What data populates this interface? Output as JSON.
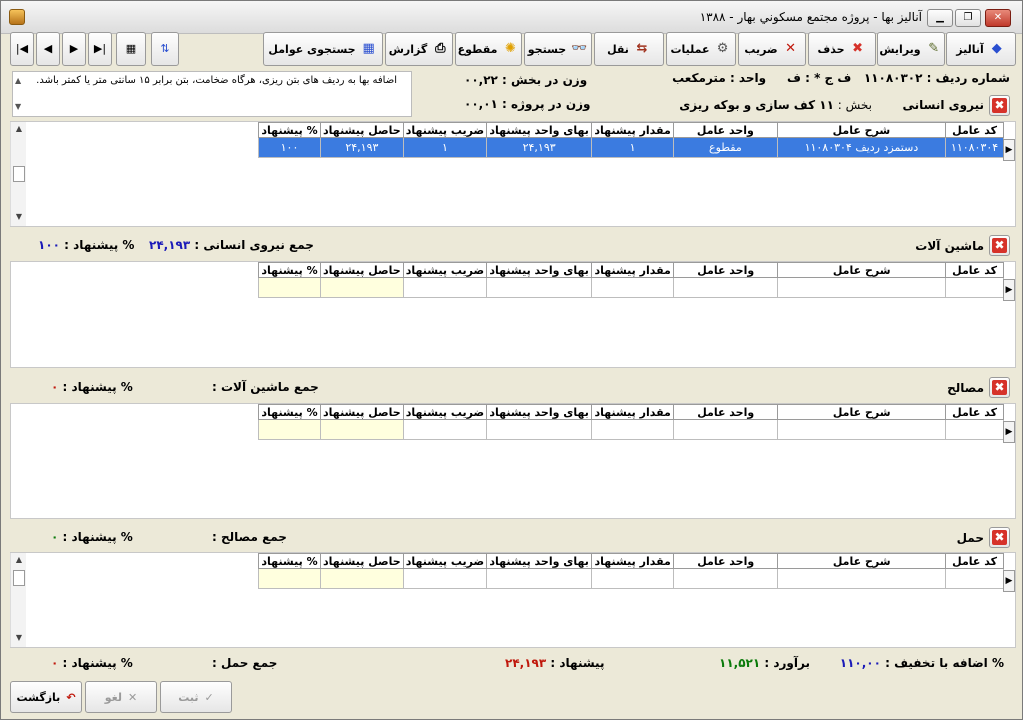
{
  "window": {
    "title": "آناليز بها - پروژه مجتمع مسكوني بهار  - ۱۳۸۸"
  },
  "toolbar": {
    "analyze": "آنالیز",
    "edit": "ویرایش",
    "delete": "حذف",
    "coef": "ضریب",
    "operations": "عملیات",
    "transfer": "نقل",
    "search": "جستجو",
    "section": "مقطوع",
    "report": "گزارش",
    "find_factors": "جستجوی عوامل"
  },
  "header": {
    "row_no_label": "شماره ردیف :",
    "row_no": "۱۱۰۸۰۳۰۲",
    "fch_label": "ف ج * : ف",
    "unit_label": "واحد :",
    "unit": "مترمکعب",
    "weight_section_label": "وزن در بخش :",
    "weight_section": "۰۰,۲۲",
    "weight_project_label": "وزن در پروژه :",
    "weight_project": "۰۰,۰۱",
    "section_label": "بخش :",
    "section": "۱۱ کف سازی و بوکه ریزی",
    "note": "اضافه بها به ردیف های بتن ریزی، هرگاه ضخامت،  بتن برابر ۱۵ سانتی متر یا کمتر باشد."
  },
  "columns": [
    "کد عامل",
    "شرح عامل",
    "واحد عامل",
    "مقدار پیشنهاد",
    "بهای واحد پیشنهاد",
    "ضریب پیشنهاد",
    "حاصل پیشنهاد",
    "% پیشنهاد"
  ],
  "sections": {
    "labor": {
      "title": "نیروی انسانی",
      "row": [
        "۱۱۰۸۰۳۰۴",
        "دستمزد ردیف ۱۱۰۸۰۳۰۴",
        "مقطوع",
        "۱",
        "۲۴,۱۹۳",
        "۱",
        "۲۴,۱۹۳",
        "۱۰۰"
      ],
      "sum_label": "جمع نیروی انسانی :",
      "sum_value": "۲۴,۱۹۳",
      "pct_label": "% پیشنهاد :",
      "pct_value": "۱۰۰"
    },
    "machinery": {
      "title": "ماشین آلات",
      "sum_label": "جمع ماشین آلات :",
      "sum_value": "",
      "pct_label": "% پیشنهاد :",
      "pct_value": "۰"
    },
    "materials": {
      "title": "مصالح",
      "sum_label": "جمع مصالح :",
      "sum_value": "",
      "pct_label": "% پیشنهاد :",
      "pct_value": "۰"
    },
    "transport": {
      "title": "حمل",
      "sum_label": "جمع حمل :",
      "sum_value": "",
      "pct_label": "% پیشنهاد :",
      "pct_value": "۰"
    }
  },
  "footer": {
    "discount_label": "% اضافه با تخفیف :",
    "discount_value": "۱۱۰,۰۰",
    "estimate_label": "برآورد :",
    "estimate_value": "۱۱,۵۲۱",
    "offer_label": "پیشنهاد :",
    "offer_value": "۲۴,۱۹۳"
  },
  "buttons": {
    "back": "بازگشت",
    "cancel": "لغو",
    "save": "ثبت"
  },
  "colors": {
    "selected_row": "#3b7be0",
    "blue_value": "#1a1ab8",
    "red_value": "#c0180c",
    "green_value": "#0a7a0a",
    "empty_cell": "#ffffde"
  }
}
